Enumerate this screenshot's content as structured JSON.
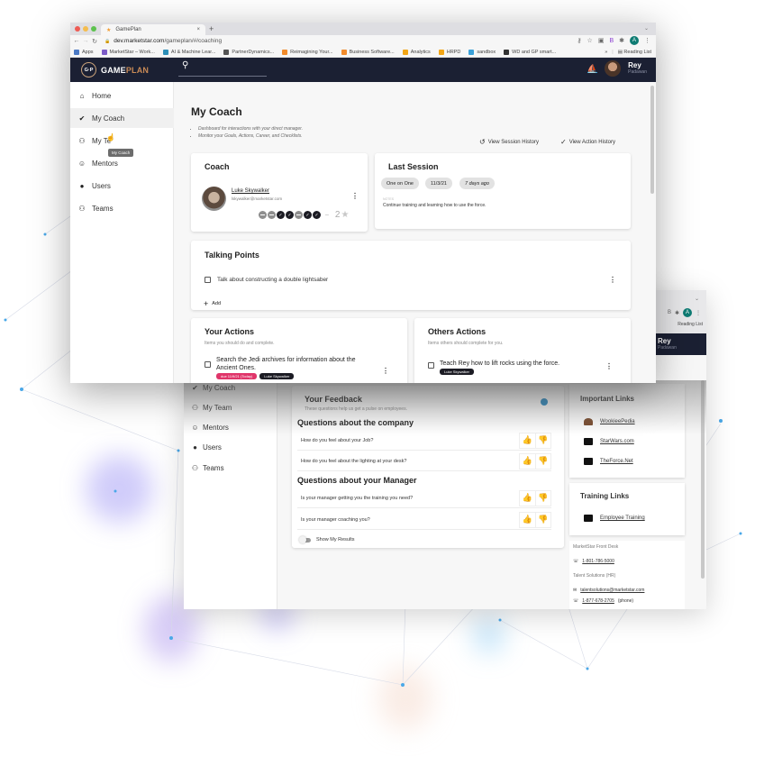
{
  "browser": {
    "tab_title": "GamePlan",
    "url_domain": "dev.marketstar.com",
    "url_path": "/gameplan/#/coaching",
    "profile_initial": "A",
    "bookmarks": [
      {
        "label": "Apps",
        "color": "#4b79c4"
      },
      {
        "label": "MarketStar – Work...",
        "color": "#7c5cc7"
      },
      {
        "label": "AI & Machine Lear...",
        "color": "#2d8fb8"
      },
      {
        "label": "PartnerDynamics...",
        "color": "#555555"
      },
      {
        "label": "Reimagining Your...",
        "color": "#f28b2c"
      },
      {
        "label": "Business Software...",
        "color": "#f28b2c"
      },
      {
        "label": "Analytics",
        "color": "#f2a516"
      },
      {
        "label": "HRPD",
        "color": "#f2a516"
      },
      {
        "label": "sandbox",
        "color": "#3aa0d8"
      },
      {
        "label": "WD and GP smart...",
        "color": "#333333"
      }
    ],
    "overflow": "»",
    "reading_list": "Reading List"
  },
  "app": {
    "logo_mark": "G·P",
    "logo_word_1": "GAME",
    "logo_word_2": "PLAN",
    "user_name": "Rey",
    "user_role": "Padawan"
  },
  "sidebar": {
    "items": [
      {
        "label": "Home",
        "icon": "⌂"
      },
      {
        "label": "My Coach",
        "icon": "✔"
      },
      {
        "label": "My Team",
        "icon": "👥"
      },
      {
        "label": "Mentors",
        "icon": "☺"
      },
      {
        "label": "Users",
        "icon": "👤"
      },
      {
        "label": "Teams",
        "icon": "👥"
      }
    ],
    "tooltip": "My Coach",
    "truncated_label": "My Te"
  },
  "page": {
    "title": "My Coach",
    "bullets": [
      "Dashboard for interactions with your direct manager.",
      "Monitor your Goals, Actions, Career, and Checklists."
    ],
    "view_session_history": "View Session History",
    "view_action_history": "View Action History"
  },
  "coach": {
    "heading": "Coach",
    "name": "Luke Skywalker",
    "email": "lskywalker@marketstar.com",
    "ratings": [
      "neg",
      "neg",
      "pos",
      "pos",
      "neg",
      "pos",
      "pos"
    ],
    "score": "2"
  },
  "last_session": {
    "heading": "Last Session",
    "chips": [
      "One on One",
      "11/3/21",
      "7 days ago"
    ],
    "notes_label": "NOTES",
    "notes": "Continue training and learning how to use the force."
  },
  "talking_points": {
    "heading": "Talking Points",
    "items": [
      "Talk about constructing a double lightsaber"
    ],
    "add_label": "Add"
  },
  "your_actions": {
    "heading": "Your Actions",
    "subtitle": "Items you should do and complete.",
    "items": [
      {
        "text_1": "Search the Jedi archives for information about the",
        "text_2": "Ancient Ones.",
        "due": "due 11/9/21 (Today)",
        "assignee": "Luke Skywalker"
      }
    ]
  },
  "others_actions": {
    "heading": "Others Actions",
    "subtitle": "Items others should complete for you.",
    "items": [
      {
        "text": "Teach Rey how to lift rocks using the force.",
        "assignee": "Luke Skywalker"
      }
    ]
  },
  "feedback": {
    "heading": "Your Feedback",
    "subtitle": "These questions help us get a pulse on employees.",
    "sections": [
      {
        "title": "Questions about the company",
        "questions": [
          "How do you feel about your Job?",
          "How do you feel about the lighting at your desk?"
        ]
      },
      {
        "title": "Questions about your Manager",
        "questions": [
          "Is your manager getting you the training you need?",
          "Is your manager coaching you?"
        ]
      }
    ],
    "toggle_label": "Show My Results"
  },
  "important_links": {
    "heading": "Important Links",
    "items": [
      "WookieePedia",
      "StarWars.com",
      "TheForce.Net"
    ]
  },
  "training_links": {
    "heading": "Training Links",
    "items": [
      "Employee Training"
    ]
  },
  "contacts": {
    "front_desk_label": "MarketStar Front Desk",
    "front_desk_phone": "1-801-786-5000",
    "hr_label": "Talent Solutions (HR)",
    "hr_email": "talentsolutions@marketstar.com",
    "hr_phone": "1-877-678-2705",
    "hr_phone_suffix": "(phone)"
  },
  "back_sidebar": {
    "items": [
      "My Coach",
      "My Team",
      "Mentors",
      "Users",
      "Teams"
    ]
  }
}
